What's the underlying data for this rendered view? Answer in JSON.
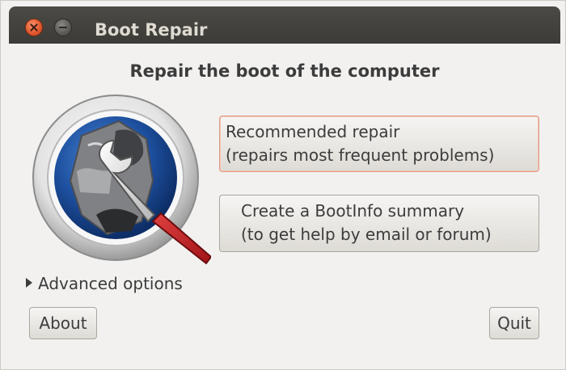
{
  "window": {
    "title": "Boot Repair"
  },
  "main": {
    "heading": "Repair the boot of the computer",
    "recommended_repair": {
      "line1": "Recommended repair",
      "line2": "(repairs most frequent problems)"
    },
    "bootinfo_summary": {
      "line1": "Create a BootInfo summary",
      "line2": "(to get help by email or forum)"
    },
    "advanced_options_label": "Advanced options"
  },
  "footer": {
    "about_label": "About",
    "quit_label": "Quit"
  },
  "colors": {
    "titlebar": "#3c3b37",
    "title_text": "#dfdbd2",
    "window_bg": "#f2f1f0",
    "close_button": "#e35a2f",
    "focus_border": "#e09a83",
    "wrench_handle": "#c8282a"
  },
  "icons": {
    "close": "close-icon",
    "minimize": "minimize-icon",
    "logo": "boot-repair-logo",
    "expander": "expander-arrow-icon"
  }
}
